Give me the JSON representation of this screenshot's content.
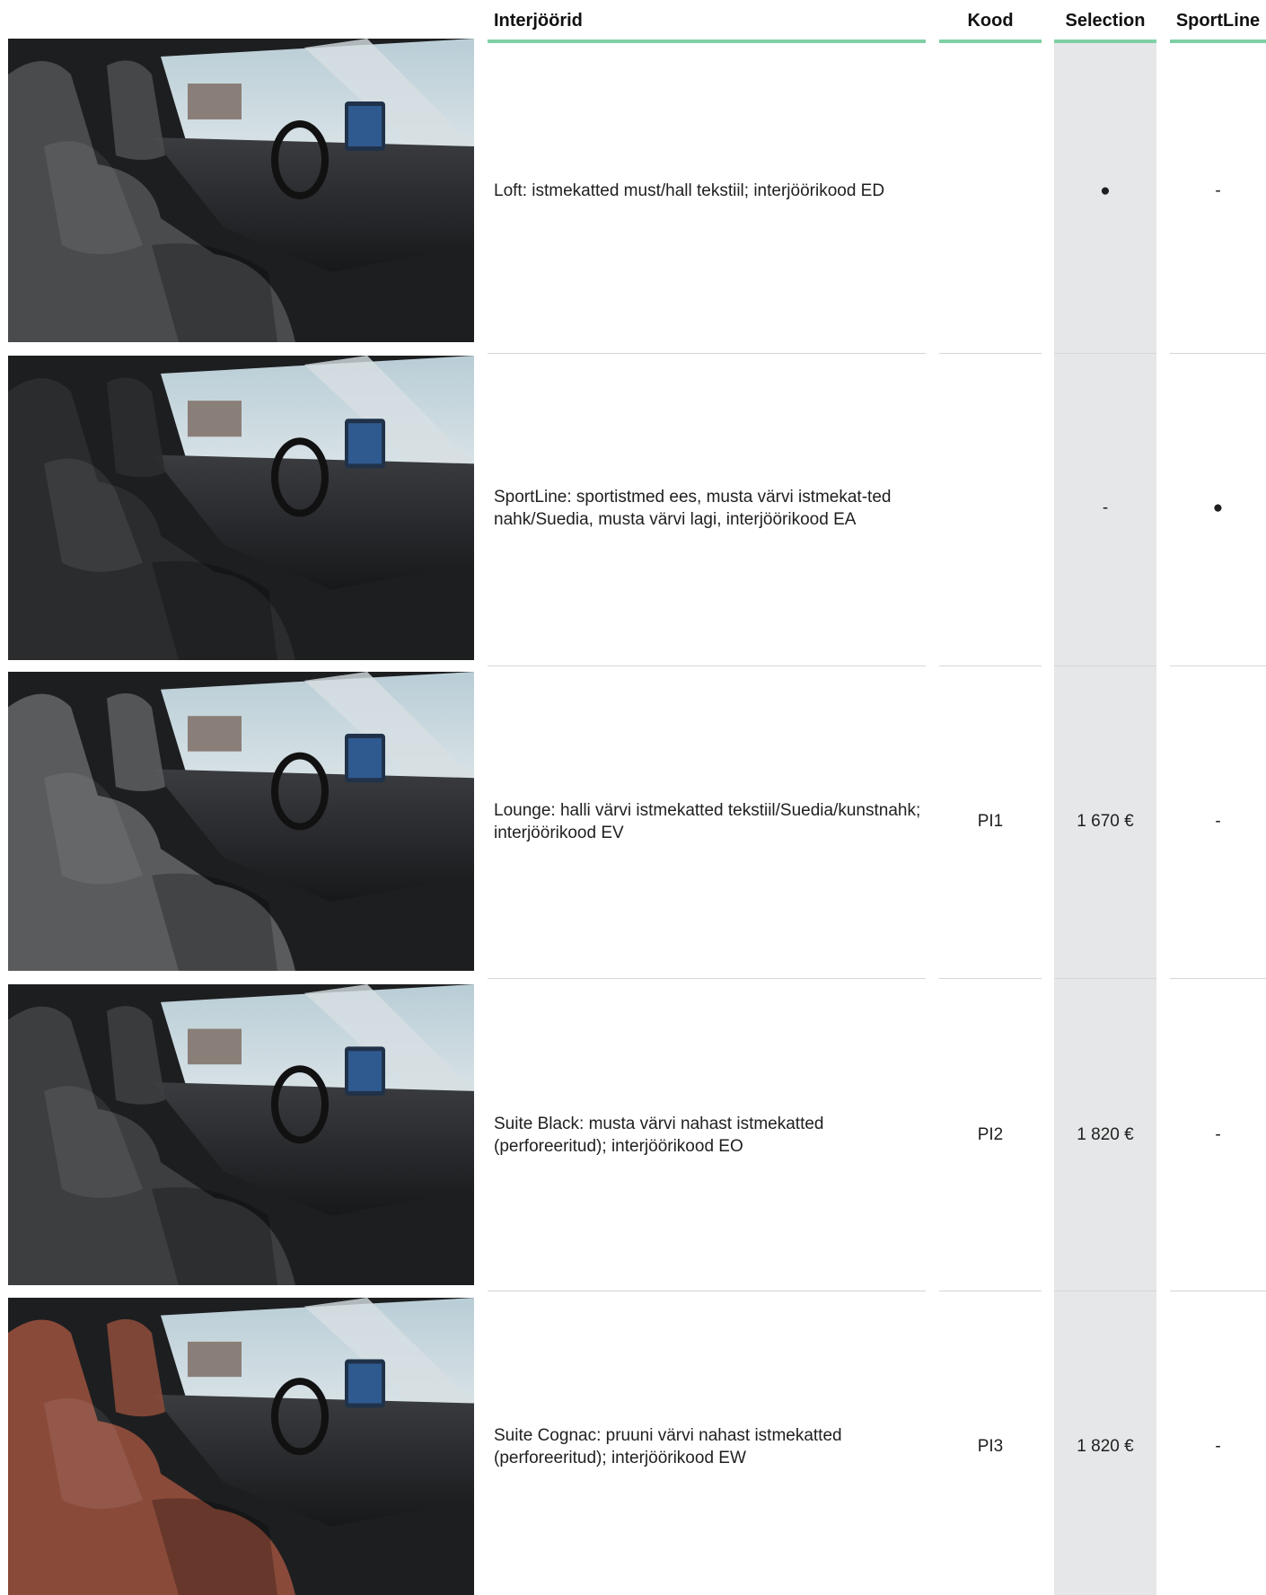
{
  "header": {
    "name": "Interjöörid",
    "code": "Kood",
    "selection": "Selection",
    "sportline": "SportLine"
  },
  "rows": [
    {
      "name": "Loft: istmekatted must/hall tekstiil; interjöörikood ED",
      "code": "",
      "selection": "●",
      "sportline": "-",
      "seat_color": "#4a4b4d"
    },
    {
      "name": "SportLine: sportistmed ees, musta värvi istmekat-ted nahk/Suedia, musta värvi lagi, interjöörikood EA",
      "code": "",
      "selection": "-",
      "sportline": "●",
      "seat_color": "#2b2c2e"
    },
    {
      "name": "Lounge: halli värvi istmekatted tekstiil/Suedia/kunstnahk; interjöörikood EV",
      "code": "PI1",
      "selection": "1 670 €",
      "sportline": "-",
      "seat_color": "#5a5b5d"
    },
    {
      "name": "Suite Black: musta värvi nahast istmekatted (perforeeritud); interjöörikood EO",
      "code": "PI2",
      "selection": "1 820 €",
      "sportline": "-",
      "seat_color": "#3d3e40"
    },
    {
      "name": "Suite Cognac: pruuni värvi nahast istmekatted (perforeeritud); interjöörikood EW",
      "code": "PI3",
      "selection": "1 820 €",
      "sportline": "-",
      "seat_color": "#8a4a3a"
    }
  ],
  "colors": {
    "header_rule": "#7fd0a4",
    "selection_band": "#e6e7e8",
    "row_rule": "#d6d6d6"
  }
}
